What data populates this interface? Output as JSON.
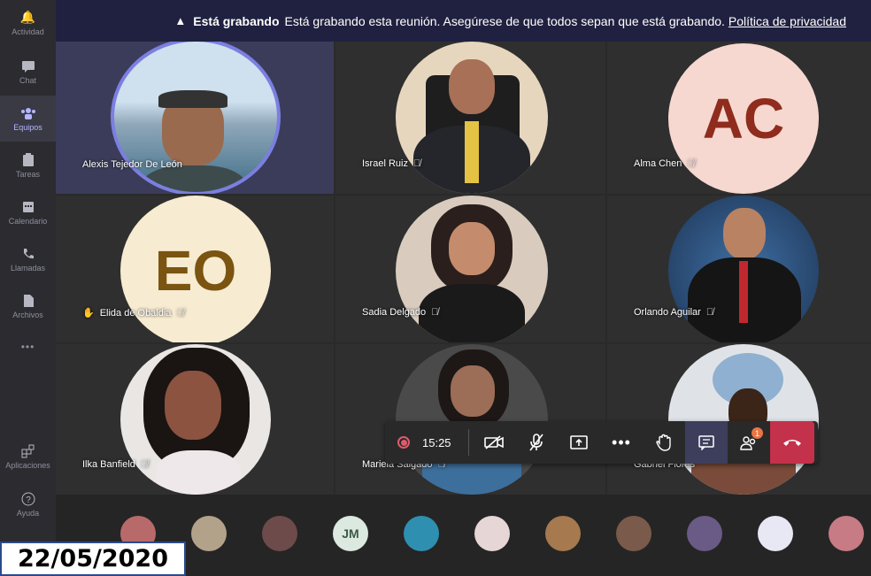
{
  "rail": {
    "items": [
      {
        "label": "Actividad",
        "icon": "bell-icon"
      },
      {
        "label": "Chat",
        "icon": "chat-icon"
      },
      {
        "label": "Equipos",
        "icon": "teams-icon"
      },
      {
        "label": "Tareas",
        "icon": "tasks-icon"
      },
      {
        "label": "Calendario",
        "icon": "calendar-icon"
      },
      {
        "label": "Llamadas",
        "icon": "phone-icon"
      },
      {
        "label": "Archivos",
        "icon": "files-icon"
      }
    ],
    "more": "•••",
    "apps_label": "Aplicaciones",
    "help_label": "Ayuda"
  },
  "banner": {
    "title": "Está grabando",
    "message": "Está grabando esta reunión. Asegúrese de que todos sepan que está grabando.",
    "link": "Política de privacidad"
  },
  "participants": [
    {
      "name": "Alexis Tejedor De León",
      "mic": ""
    },
    {
      "name": "Israel Ruiz",
      "mic": "🎙̸"
    },
    {
      "name": "Alma Chen",
      "mic": "🎙̸",
      "initials": "AC"
    },
    {
      "name": "Elida de Obaldia",
      "mic": "🎙̸",
      "initials": "EO",
      "hand": "✋"
    },
    {
      "name": "Sadia Delgado",
      "mic": "🎙̸"
    },
    {
      "name": "Orlando Aguilar",
      "mic": "🎙̸"
    },
    {
      "name": "Ilka Banfield",
      "mic": "🎙̸"
    },
    {
      "name": "Mariela Salgado",
      "mic": "🎙̸"
    },
    {
      "name": "Gabriel Flores",
      "mic": ""
    }
  ],
  "toolbar": {
    "time": "15:25",
    "participants_badge": "1"
  },
  "strip": {
    "initials": "JM"
  },
  "date": "22/05/2020",
  "colors": {
    "banner": "#202140",
    "hangup": "#c4314b",
    "accent": "#b4b6ff"
  }
}
